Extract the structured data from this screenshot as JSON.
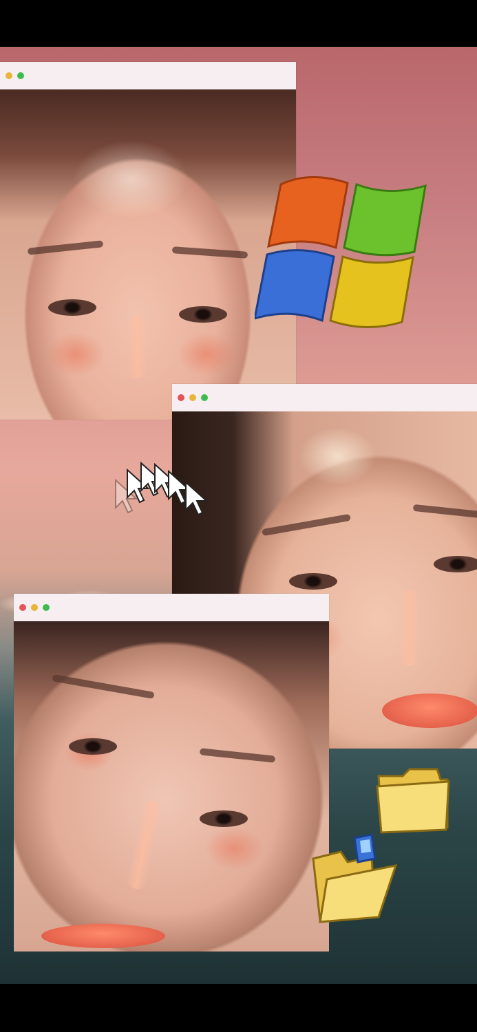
{
  "windows": [
    {
      "id": "window-1",
      "controls": [
        "close",
        "minimize",
        "maximize"
      ]
    },
    {
      "id": "window-2",
      "controls": [
        "close",
        "minimize",
        "maximize"
      ]
    },
    {
      "id": "window-3",
      "controls": [
        "close",
        "minimize",
        "maximize"
      ]
    }
  ],
  "icons": {
    "logo": "windows-logo-icon",
    "cursors": "mouse-cursor-trail-icon",
    "folder_closed": "folder-icon",
    "folder_open": "open-folder-icon"
  },
  "colors": {
    "close": "#e2555b",
    "minimize": "#e9b43a",
    "maximize": "#3fbb4e",
    "titlebar": "#f6eef0",
    "sky": "#c87f82",
    "sea": "#2b4547"
  }
}
